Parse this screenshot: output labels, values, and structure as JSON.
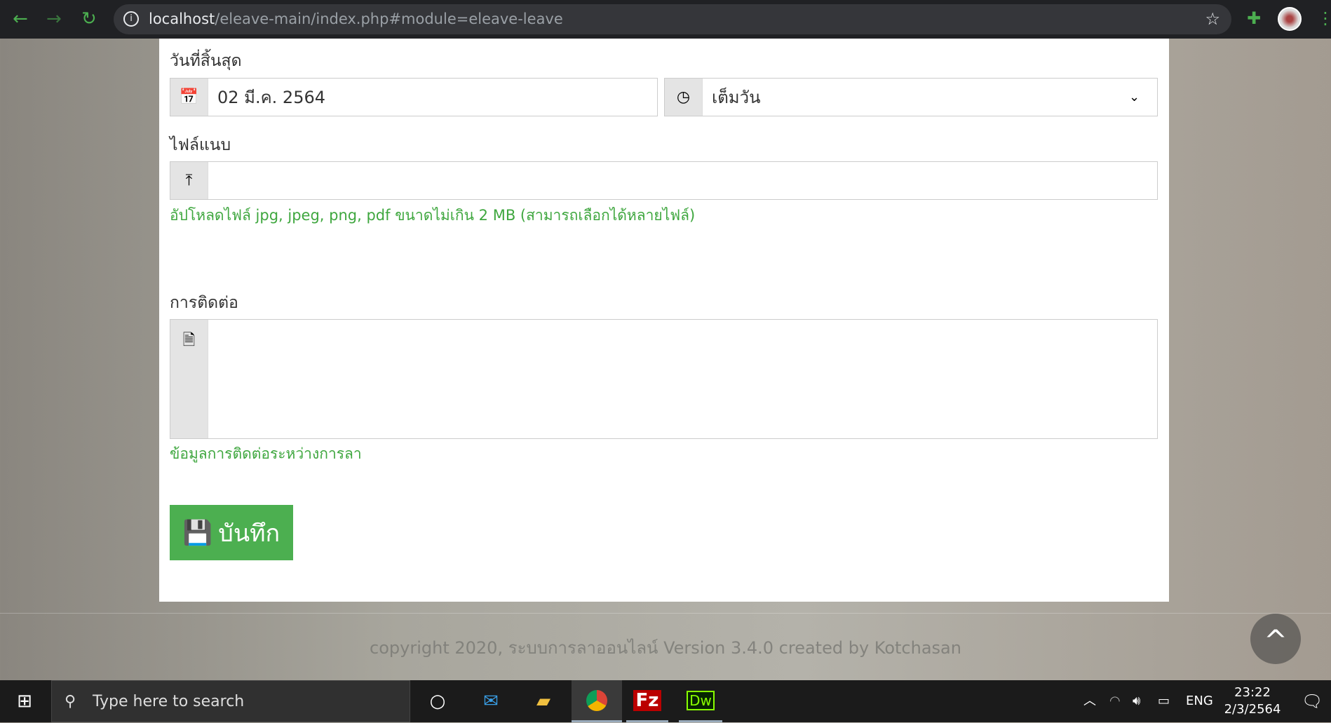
{
  "browser": {
    "url_host": "localhost",
    "url_path": "/eleave-main/index.php#module=eleave-leave"
  },
  "form": {
    "end_date_label": "วันที่สิ้นสุด",
    "end_date_value": "02 มี.ค. 2564",
    "time_value": "เต็มวัน",
    "attachment_label": "ไฟล์แนบ",
    "attachment_hint": "อัปโหลดไฟล์ jpg, jpeg, png, pdf ขนาดไม่เกิน 2 MB (สามารถเลือกได้หลายไฟล์)",
    "contact_label": "การติดต่อ",
    "contact_value": "",
    "contact_hint": "ข้อมูลการติดต่อระหว่างการลา",
    "save_label": "บันทึก"
  },
  "footer": {
    "text": "copyright 2020, ระบบการลาออนไลน์ Version 3.4.0 created by Kotchasan"
  },
  "taskbar": {
    "search_placeholder": "Type here to search",
    "lang": "ENG",
    "time": "23:22",
    "date": "2/3/2564"
  },
  "colors": {
    "accent": "#4caf50",
    "hint": "#3fa73f"
  }
}
